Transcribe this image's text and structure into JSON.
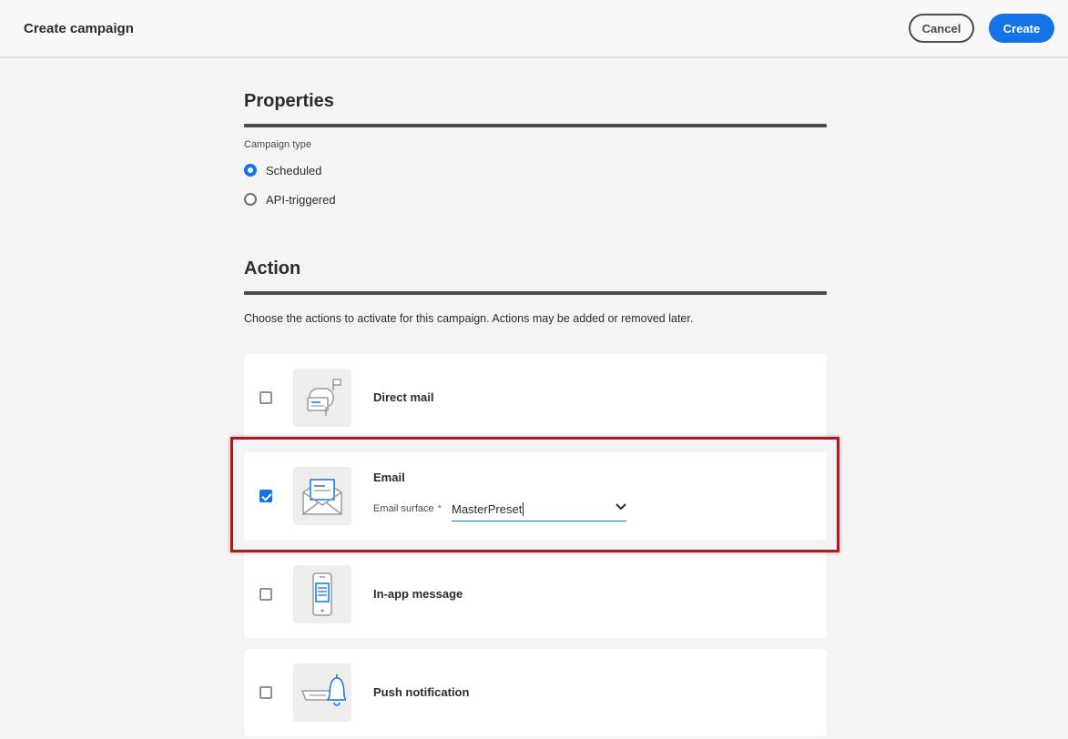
{
  "header": {
    "title": "Create campaign",
    "cancel_label": "Cancel",
    "create_label": "Create"
  },
  "properties": {
    "title": "Properties",
    "campaign_type_label": "Campaign type",
    "options": [
      {
        "label": "Scheduled",
        "selected": true
      },
      {
        "label": "API-triggered",
        "selected": false
      }
    ]
  },
  "action": {
    "title": "Action",
    "help_text": "Choose the actions to activate for this campaign. Actions may be added or removed later.",
    "items": [
      {
        "label": "Direct mail",
        "checked": false,
        "icon": "mailbox-icon"
      },
      {
        "label": "Email",
        "checked": true,
        "icon": "envelope-icon",
        "surface_label": "Email surface",
        "surface_required": "*",
        "surface_value": "MasterPreset"
      },
      {
        "label": "In-app message",
        "checked": false,
        "icon": "phone-message-icon"
      },
      {
        "label": "Push notification",
        "checked": false,
        "icon": "bell-icon"
      }
    ]
  },
  "colors": {
    "accent": "#1473e6",
    "highlight": "#b3161b"
  }
}
